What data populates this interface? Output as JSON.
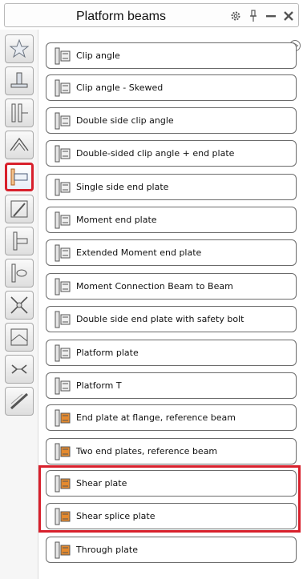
{
  "window": {
    "title": "Platform beams",
    "controls": [
      "gear-icon",
      "pin-icon",
      "minimize-icon",
      "close-icon"
    ]
  },
  "sidebar": {
    "items": [
      {
        "icon": "favorites-star-icon",
        "active": false
      },
      {
        "icon": "base-plate-icon",
        "active": false
      },
      {
        "icon": "column-beam-icon",
        "active": false
      },
      {
        "icon": "roof-apex-icon",
        "active": false
      },
      {
        "icon": "platform-beams-icon",
        "active": true
      },
      {
        "icon": "bracing-icon",
        "active": false
      },
      {
        "icon": "beam-to-column-icon",
        "active": false
      },
      {
        "icon": "pipe-connection-icon",
        "active": false
      },
      {
        "icon": "cross-bracing-icon",
        "active": false
      },
      {
        "icon": "purlin-icon",
        "active": false
      },
      {
        "icon": "splice-icon",
        "active": false
      },
      {
        "icon": "diagonal-member-icon",
        "active": false
      }
    ]
  },
  "connections": {
    "items": [
      {
        "label": "Clip angle",
        "icon": "clip-angle-icon"
      },
      {
        "label": "Clip angle - Skewed",
        "icon": "clip-angle-skewed-icon"
      },
      {
        "label": "Double side clip angle",
        "icon": "double-side-clip-angle-icon"
      },
      {
        "label": "Double-sided clip angle + end plate",
        "icon": "double-clip-angle-end-plate-icon"
      },
      {
        "label": "Single side end plate",
        "icon": "single-side-end-plate-icon"
      },
      {
        "label": "Moment end plate",
        "icon": "moment-end-plate-icon"
      },
      {
        "label": "Extended Moment end plate",
        "icon": "extended-moment-end-plate-icon"
      },
      {
        "label": "Moment Connection Beam to Beam",
        "icon": "moment-connection-beam-icon"
      },
      {
        "label": "Double side end plate with safety bolt",
        "icon": "double-end-plate-safety-bolt-icon"
      },
      {
        "label": "Platform plate",
        "icon": "platform-plate-icon"
      },
      {
        "label": "Platform T",
        "icon": "platform-t-icon"
      },
      {
        "label": "End plate at flange, reference beam",
        "icon": "end-plate-flange-icon"
      },
      {
        "label": "Two end plates, reference beam",
        "icon": "two-end-plates-icon"
      },
      {
        "label": "Shear plate",
        "icon": "shear-plate-icon"
      },
      {
        "label": "Shear splice plate",
        "icon": "shear-splice-plate-icon"
      },
      {
        "label": "Through plate",
        "icon": "through-plate-icon"
      }
    ],
    "highlighted": [
      "Shear plate",
      "Shear splice plate"
    ]
  },
  "colors": {
    "highlight": "#d8202c",
    "icon_orange": "#e58a2e",
    "icon_grey": "#555555"
  }
}
